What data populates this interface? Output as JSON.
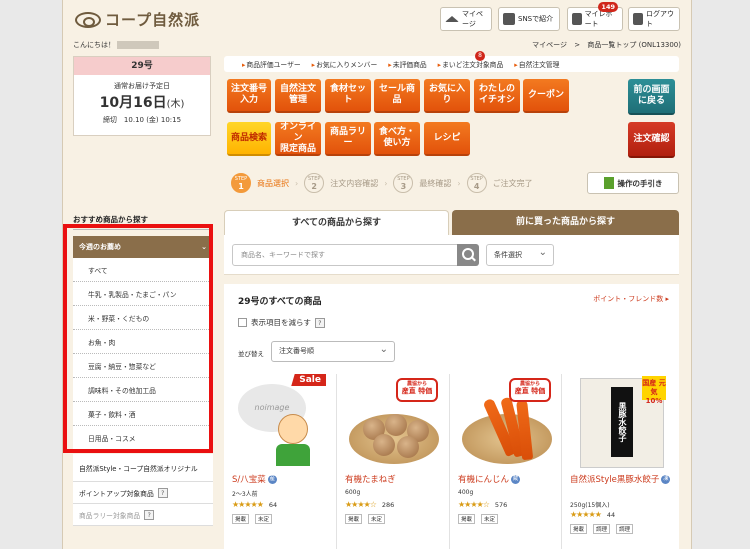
{
  "header": {
    "logo_text": "コープ自然派",
    "buttons": [
      {
        "label": "マイページ",
        "icon": "home-icon"
      },
      {
        "label": "SNSで紹介",
        "icon": "envelope-icon"
      },
      {
        "label": "マイレポート",
        "icon": "report-icon",
        "badge": "149"
      },
      {
        "label": "ログアウト",
        "icon": "lock-icon"
      }
    ]
  },
  "greeting": "こんにちは！",
  "breadcrumb": {
    "home": "マイページ",
    "sep": ">",
    "current": "商品一覧トップ (ONL13300)"
  },
  "delivery": {
    "issue": "29号",
    "label": "通常お届け予定日",
    "date": "10月16日",
    "dow": "(木)",
    "deadline": "締切　10.10 (金) 10:15"
  },
  "nav_links": {
    "items": [
      "商品評価ユーザー",
      "お気に入りメンバー",
      "未評価商品",
      "まいど注文対象商品",
      "自然注文管理"
    ],
    "badge": "8"
  },
  "orange_buttons": {
    "row1": [
      "注文番号\n入力",
      "自然注文\n管理",
      "食材セット",
      "セール商品",
      "お気に入り",
      "わたしの\nイチオシ",
      "クーポン"
    ],
    "row2": [
      "商品検索",
      "オンライン\n限定商品",
      "商品ラリー",
      "食べ方・\n使い方",
      "レシピ"
    ],
    "back": "前の画面\nに戻る",
    "confirm": "注文確認"
  },
  "steps": {
    "items": [
      {
        "num": "1",
        "label": "商品選択"
      },
      {
        "num": "2",
        "label": "注文内容確認"
      },
      {
        "num": "3",
        "label": "最終確認"
      },
      {
        "num": "4",
        "label": "ご注文完了"
      }
    ],
    "step_word": "STEP"
  },
  "manual_button": "操作の手引き",
  "sidebar": {
    "title": "おすすめ商品から探す",
    "weekly_head": "今週のお薦め",
    "weekly_items": [
      "すべて",
      "牛乳・乳製品・たまご・パン",
      "米・野菜・くだもの",
      "お魚・肉",
      "豆腐・納豆・惣菜など",
      "調味料・その他加工品",
      "菓子・飲料・酒",
      "日用品・コスメ"
    ],
    "links": [
      "自然派Style・コープ自然派オリジナル",
      "ポイントアップ対象商品",
      "商品ラリー対象商品"
    ]
  },
  "tabs": {
    "active": "すべての商品から探す",
    "other": "前に買った商品から探す"
  },
  "search": {
    "placeholder": "商品名、キーワードで探す",
    "condition": "条件選択"
  },
  "list": {
    "title": "29号のすべての商品",
    "points_link": "ポイント・フレンド数",
    "reduce_label": "表示項目を減らす",
    "sort_label": "並び替え",
    "sort_value": "注文番号順"
  },
  "products": [
    {
      "name": "S/八宝菜",
      "badge": "産",
      "sub": "2〜3人前",
      "stars": "★★★★★",
      "count": "64",
      "tags": [
        "掲載",
        "未定"
      ],
      "flag": "Sale",
      "img_text": "noimage"
    },
    {
      "name": "有機たまねぎ",
      "badge": "",
      "sub": "600g",
      "stars": "★★★★☆",
      "count": "286",
      "tags": [
        "掲載",
        "未定"
      ],
      "flag_top": "農協から",
      "flag_main": "産直 特価"
    },
    {
      "name": "有機にんじん",
      "badge": "蔵",
      "sub": "400g",
      "stars": "★★★★☆",
      "count": "576",
      "tags": [
        "掲載",
        "未定"
      ],
      "flag_top": "農協から",
      "flag_main": "産直 特価"
    },
    {
      "name": "自然派Style黒豚水餃子",
      "badge": "凍",
      "sub": "250g(15個入)",
      "stars": "★★★★★",
      "count": "44",
      "tags": [
        "掲載",
        "調理",
        "調理"
      ],
      "flag_top": "国産 元気",
      "flag_main": "10%",
      "img_text": "黒豚水餃子"
    }
  ],
  "colors": {
    "orange": "#e8620f",
    "brown": "#8a6e4a",
    "accent_red": "#ea1010",
    "teal": "#1f6f77"
  }
}
